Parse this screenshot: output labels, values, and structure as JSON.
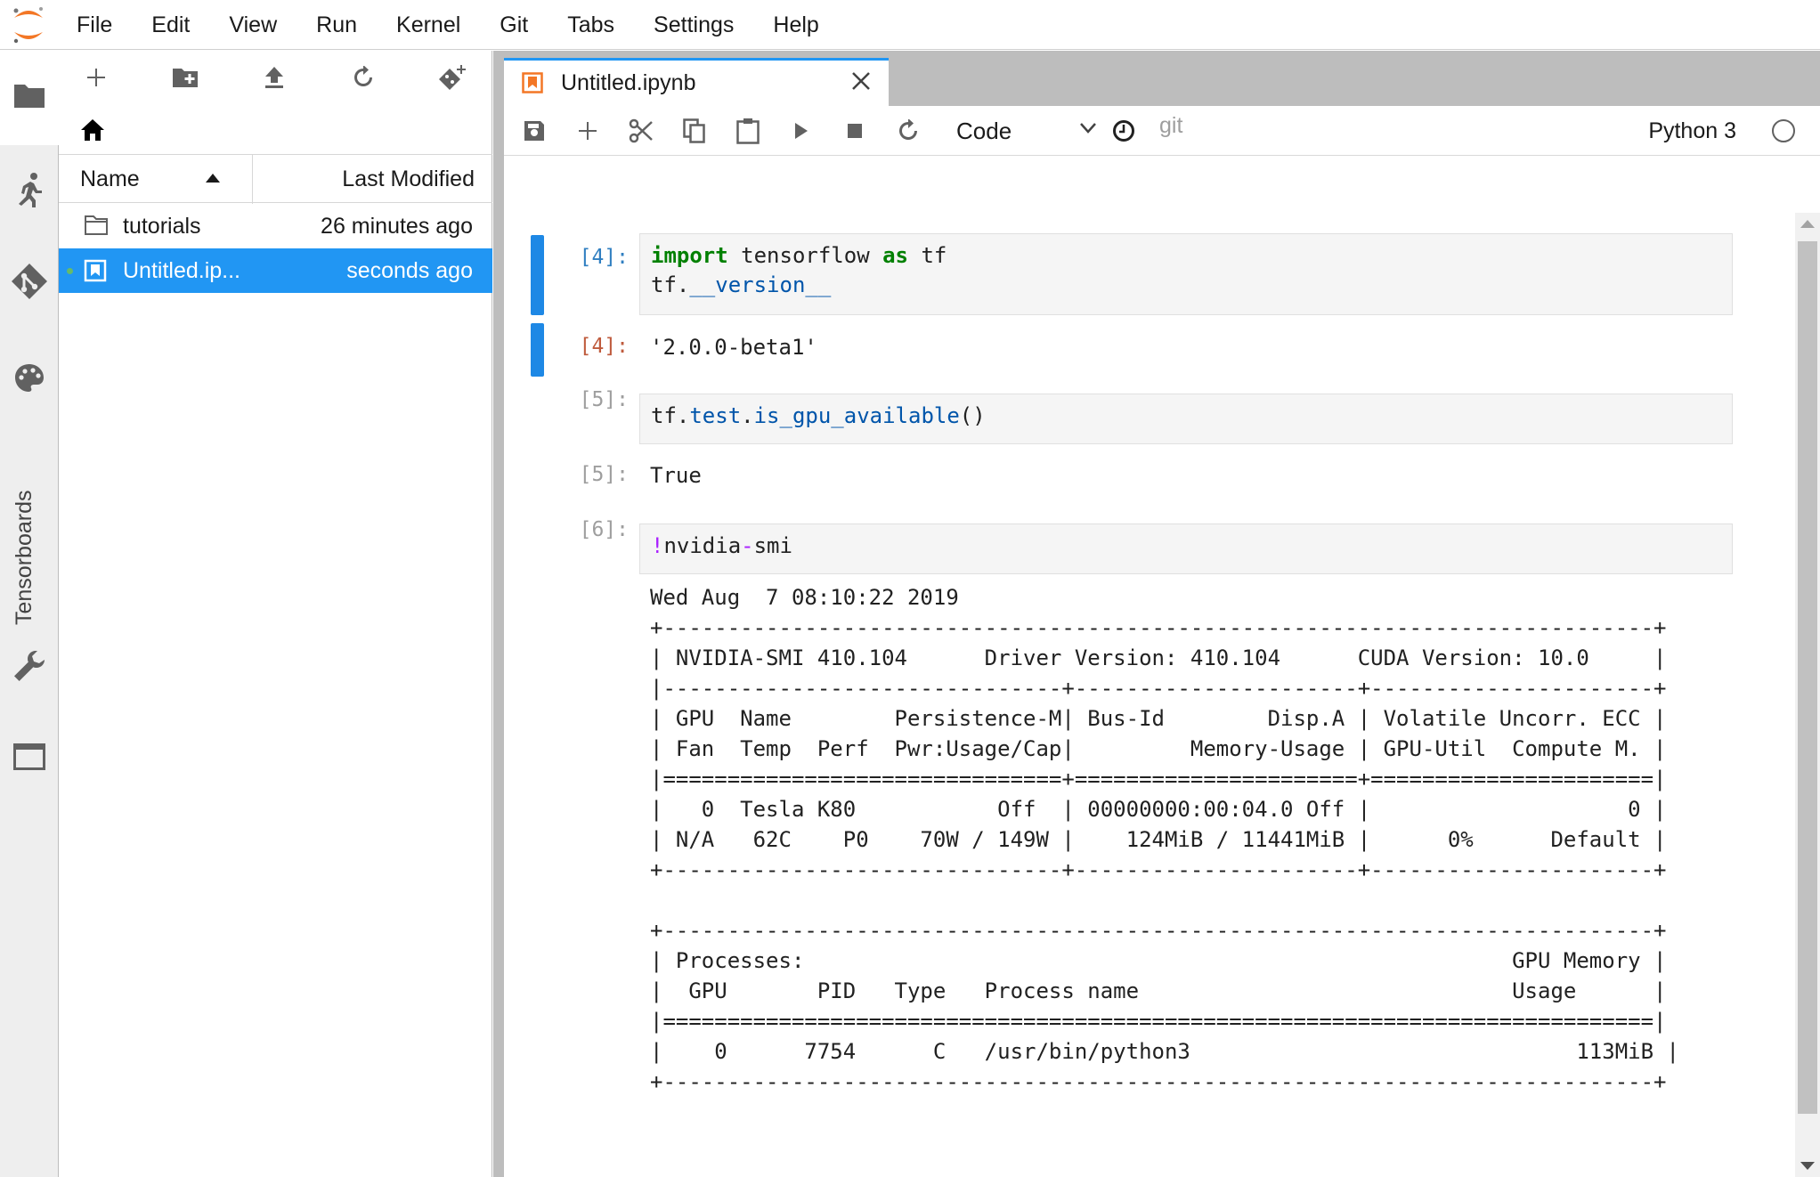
{
  "menubar": {
    "items": [
      "File",
      "Edit",
      "View",
      "Run",
      "Kernel",
      "Git",
      "Tabs",
      "Settings",
      "Help"
    ]
  },
  "sidebar": {
    "tensorboards_label": "Tensorboards",
    "icons": [
      "folder-icon",
      "running-icon",
      "git-icon",
      "palette-icon",
      "wrench-icon",
      "tabs-icon"
    ]
  },
  "filebrowser": {
    "columns": {
      "name": "Name",
      "modified": "Last Modified"
    },
    "rows": [
      {
        "name": "tutorials",
        "modified": "26 minutes ago",
        "type": "folder"
      },
      {
        "name": "Untitled.ip...",
        "modified": "seconds ago",
        "type": "notebook"
      }
    ]
  },
  "tab": {
    "title": "Untitled.ipynb"
  },
  "toolbar": {
    "cell_type": "Code",
    "git_label": "git",
    "kernel_name": "Python 3"
  },
  "cells": {
    "c1": {
      "prompt_in": "[4]:",
      "prompt_out": "[4]:",
      "output": "'2.0.0-beta1'"
    },
    "c2": {
      "prompt_in": "[5]:",
      "prompt_out": "[5]:",
      "output": "True"
    },
    "c3": {
      "prompt_in": "[6]:",
      "output": "Wed Aug  7 08:10:22 2019       \n+-----------------------------------------------------------------------------+\n| NVIDIA-SMI 410.104      Driver Version: 410.104      CUDA Version: 10.0     |\n|-------------------------------+----------------------+----------------------+\n| GPU  Name        Persistence-M| Bus-Id        Disp.A | Volatile Uncorr. ECC |\n| Fan  Temp  Perf  Pwr:Usage/Cap|         Memory-Usage | GPU-Util  Compute M. |\n|===============================+======================+======================|\n|   0  Tesla K80           Off  | 00000000:00:04.0 Off |                    0 |\n| N/A   62C    P0    70W / 149W |    124MiB / 11441MiB |      0%      Default |\n+-------------------------------+----------------------+----------------------+\n                                                                               \n+-----------------------------------------------------------------------------+\n| Processes:                                                       GPU Memory |\n|  GPU       PID   Type   Process name                             Usage      |\n|=============================================================================|\n|    0      7754      C   /usr/bin/python3                              113MiB |\n+-----------------------------------------------------------------------------+"
    }
  },
  "code_tokens": {
    "import": "import",
    "tensorflow": " tensorflow ",
    "as": "as",
    "tf": " tf",
    "line2a": "tf.",
    "version": "__version__",
    "c2a": "tf.",
    "c2b": "test",
    "c2c": ".",
    "c2d": "is_gpu_available",
    "c2e": "()",
    "bang": "!",
    "nvidia": "nvidia",
    "dash": "-",
    "smi": "smi"
  },
  "colors": {
    "accent": "#2196f3",
    "selected_row": "#2196f3",
    "running_dot": "#66bb6a",
    "jupyter_orange": "#f37726"
  }
}
